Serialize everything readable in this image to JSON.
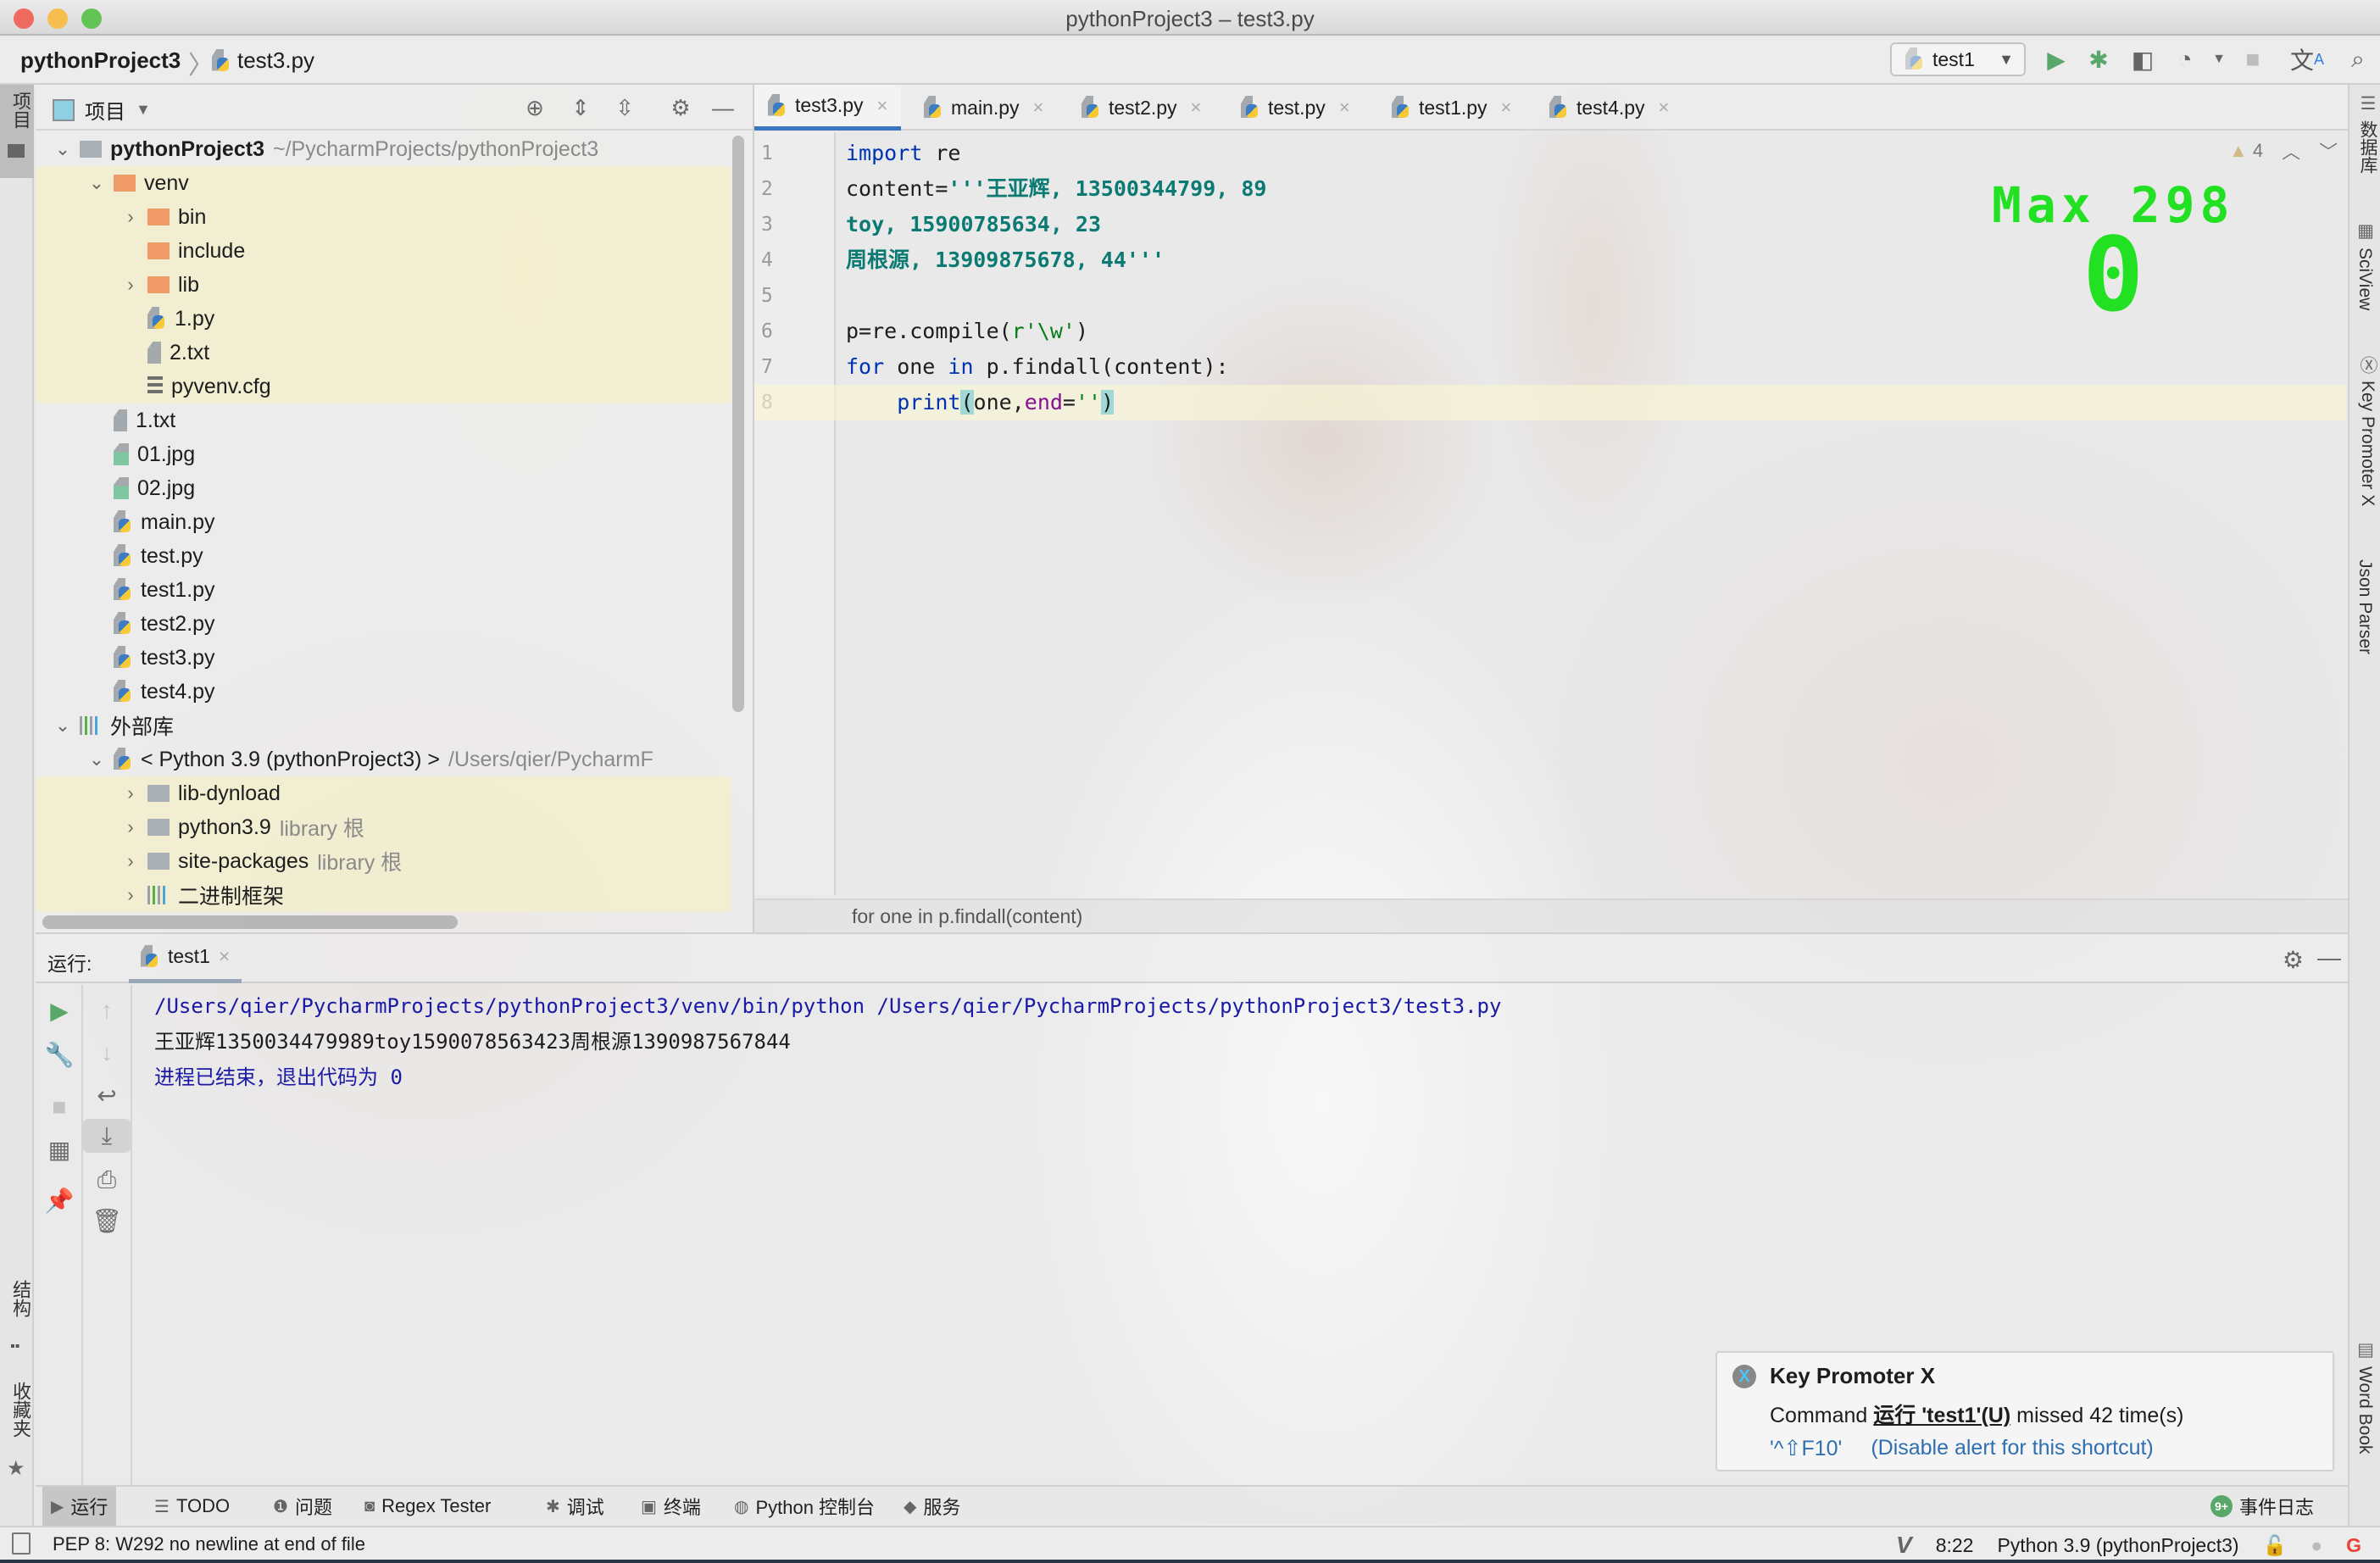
{
  "window": {
    "title": "pythonProject3 – test3.py"
  },
  "navbar": {
    "project": "pythonProject3",
    "file": "test3.py",
    "run_config": "test1",
    "icons": [
      "run-icon",
      "debug-icon",
      "coverage-icon",
      "profile-icon",
      "stop-icon",
      "translate-icon",
      "search-icon"
    ]
  },
  "left_strip": {
    "project_label": "项目",
    "structure_label": "结构",
    "favorites_label": "收藏夹"
  },
  "project_panel": {
    "title": "项目",
    "tree": [
      {
        "label": "pythonProject3",
        "hint": "~/PycharmProjects/pythonProject3",
        "type": "folder-grey",
        "depth": 0,
        "expanded": true,
        "bold": true
      },
      {
        "label": "venv",
        "type": "folder-orange",
        "depth": 1,
        "expanded": true,
        "highlight": true
      },
      {
        "label": "bin",
        "type": "folder-orange",
        "depth": 2,
        "expanded": false,
        "highlight": true
      },
      {
        "label": "include",
        "type": "folder-orange",
        "depth": 2,
        "highlight": true
      },
      {
        "label": "lib",
        "type": "folder-orange",
        "depth": 2,
        "expanded": false,
        "highlight": true
      },
      {
        "label": "1.py",
        "type": "py",
        "depth": 2,
        "highlight": true
      },
      {
        "label": "2.txt",
        "type": "txt",
        "depth": 2,
        "highlight": true
      },
      {
        "label": "pyvenv.cfg",
        "type": "cfg",
        "depth": 2,
        "highlight": true
      },
      {
        "label": "1.txt",
        "type": "txt",
        "depth": 1
      },
      {
        "label": "01.jpg",
        "type": "img",
        "depth": 1
      },
      {
        "label": "02.jpg",
        "type": "img",
        "depth": 1
      },
      {
        "label": "main.py",
        "type": "py",
        "depth": 1
      },
      {
        "label": "test.py",
        "type": "py",
        "depth": 1
      },
      {
        "label": "test1.py",
        "type": "py",
        "depth": 1
      },
      {
        "label": "test2.py",
        "type": "py",
        "depth": 1
      },
      {
        "label": "test3.py",
        "type": "py",
        "depth": 1
      },
      {
        "label": "test4.py",
        "type": "py",
        "depth": 1
      },
      {
        "label": "外部库",
        "type": "lib",
        "depth": 0,
        "expanded": true
      },
      {
        "label": "< Python 3.9 (pythonProject3) >",
        "hint": "/Users/qier/PycharmF",
        "type": "python",
        "depth": 1,
        "expanded": true
      },
      {
        "label": "lib-dynload",
        "type": "folder-grey",
        "depth": 2,
        "expanded": false,
        "highlight": true
      },
      {
        "label": "python3.9",
        "hint": "library 根",
        "type": "folder-grey",
        "depth": 2,
        "expanded": false,
        "highlight": true
      },
      {
        "label": "site-packages",
        "hint": "library 根",
        "type": "folder-grey",
        "depth": 2,
        "expanded": false,
        "highlight": true
      },
      {
        "label": "二进制框架",
        "type": "lib",
        "depth": 2,
        "expanded": false,
        "highlight": true
      }
    ]
  },
  "editor": {
    "tabs": [
      {
        "label": "test3.py",
        "active": true
      },
      {
        "label": "main.py"
      },
      {
        "label": "test2.py"
      },
      {
        "label": "test.py"
      },
      {
        "label": "test1.py"
      },
      {
        "label": "test4.py"
      }
    ],
    "line_numbers": [
      "1",
      "2",
      "3",
      "4",
      "5",
      "6",
      "7",
      "8"
    ],
    "lines": [
      [
        {
          "t": "import",
          "c": "kw"
        },
        {
          "t": " re",
          "c": "fn"
        }
      ],
      [
        {
          "t": "content=",
          "c": "fn"
        },
        {
          "t": "'''王亚辉, 13500344799, 89",
          "c": "strc"
        }
      ],
      [
        {
          "t": "toy, 15900785634, 23",
          "c": "strc"
        }
      ],
      [
        {
          "t": "周根源, 13909875678, 44'''",
          "c": "strc"
        }
      ],
      [],
      [
        {
          "t": "p=re.compile(",
          "c": "fn"
        },
        {
          "t": "r'\\w'",
          "c": "str"
        },
        {
          "t": ")",
          "c": "fn"
        }
      ],
      [
        {
          "t": "for",
          "c": "kw"
        },
        {
          "t": " one ",
          "c": "fn"
        },
        {
          "t": "in",
          "c": "kw"
        },
        {
          "t": " p.findall(content):",
          "c": "fn"
        }
      ],
      [
        {
          "t": "    ",
          "c": "fn"
        },
        {
          "t": "print",
          "c": "kw"
        },
        {
          "t": "(",
          "c": "brace-hl"
        },
        {
          "t": "one,",
          "c": "fn"
        },
        {
          "t": "end",
          "c": "kwarg"
        },
        {
          "t": "=",
          "c": "fn"
        },
        {
          "t": "''",
          "c": "str"
        },
        {
          "t": ")",
          "c": "brace-hl"
        }
      ]
    ],
    "current_line": 8,
    "warning_count": "4",
    "breadcrumb": "for one in p.findall(content)"
  },
  "overlay": {
    "max_label": "Max 298",
    "value": "0",
    "color": "#22e022"
  },
  "right_strip": {
    "items": [
      "数据库",
      "SciView",
      "Key Promoter X",
      "Json Parser",
      "Word Book"
    ]
  },
  "run_panel": {
    "label": "运行:",
    "tab": "test1",
    "console": [
      {
        "text": "/Users/qier/PycharmProjects/pythonProject3/venv/bin/python /Users/qier/PycharmProjects/pythonProject3/test3.py",
        "kind": "c-path"
      },
      {
        "text": "王亚辉1350034479989toy1590078563423周根源1390987567844",
        "kind": "c-out"
      },
      {
        "text": "进程已结束，退出代码为 0",
        "kind": "c-exit"
      }
    ]
  },
  "key_promoter": {
    "title": "Key Promoter X",
    "prefix": "Command",
    "command": "运行 'test1'(U)",
    "suffix": "missed 42 time(s)",
    "shortcut": "'^⇧F10'",
    "disable_link": "(Disable alert for this shortcut)"
  },
  "bottom_tools": {
    "items": [
      {
        "label": "运行",
        "icon": "▶",
        "active": true
      },
      {
        "label": "TODO",
        "icon": "☰"
      },
      {
        "label": "问题",
        "icon": "❶"
      },
      {
        "label": "Regex Tester",
        "icon": "◙"
      },
      {
        "label": "调试",
        "icon": "✱"
      },
      {
        "label": "终端",
        "icon": "▣"
      },
      {
        "label": "Python 控制台",
        "icon": "◍"
      },
      {
        "label": "服务",
        "icon": "◆"
      }
    ],
    "event_log": "事件日志",
    "event_badge": "9+"
  },
  "statusbar": {
    "message": "PEP 8: W292 no newline at end of file",
    "position": "8:22",
    "interpreter": "Python 3.9 (pythonProject3)"
  }
}
